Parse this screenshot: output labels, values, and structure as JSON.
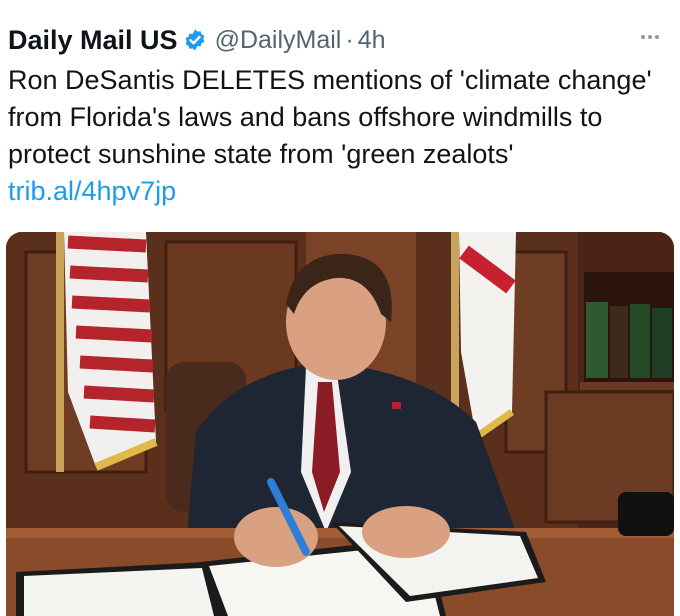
{
  "tweet": {
    "author_name": "Daily Mail US",
    "verified_icon": "verified-badge-icon",
    "handle": "@DailyMail",
    "separator": "·",
    "time": "4h",
    "more_icon": "more-options-icon",
    "text": "Ron DeSantis DELETES mentions of 'climate change' from Florida's laws and bans offshore windmills to protect sunshine state from 'green zealots'",
    "link": "trib.al/4hpv7jp"
  },
  "colors": {
    "text": "#0f1419",
    "secondary": "#536471",
    "link": "#1d9bf0",
    "verified": "#1d9bf0"
  }
}
